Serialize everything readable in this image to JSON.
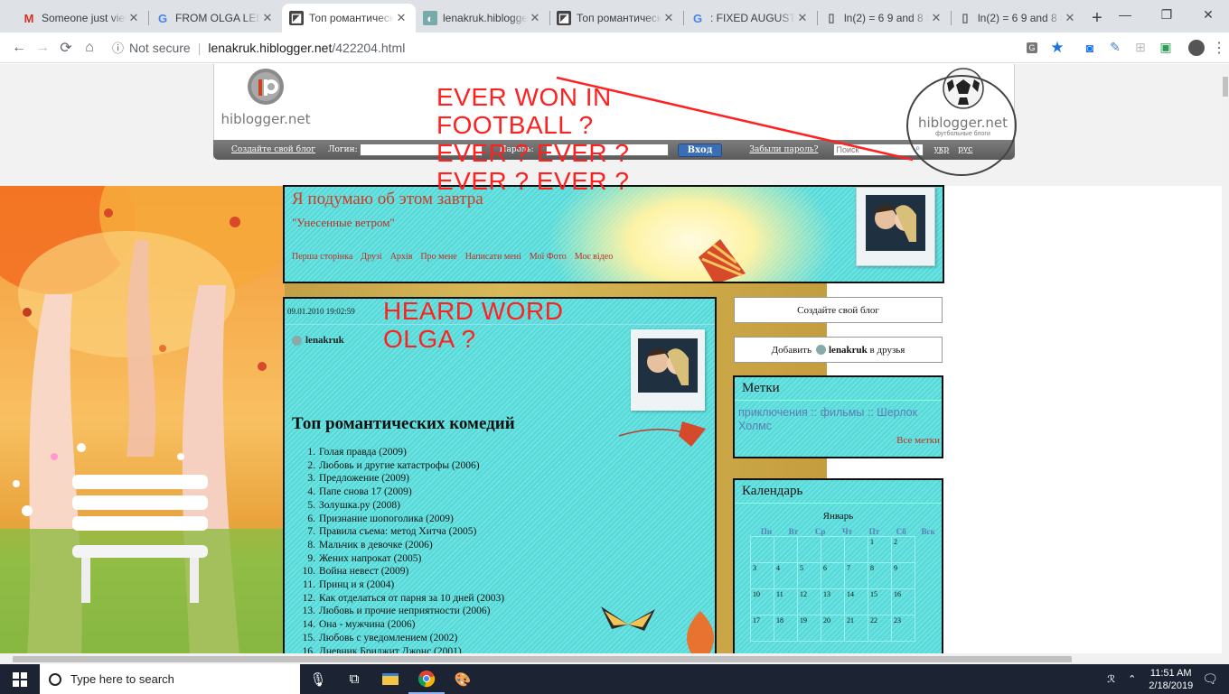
{
  "browser": {
    "tabs": [
      {
        "title": "Someone just view",
        "icon": "gmail-icon",
        "active": false
      },
      {
        "title": "FROM OLGA LEDN",
        "icon": "google-icon",
        "active": false
      },
      {
        "title": "Топ романтическ",
        "icon": "hiblogger-icon",
        "active": true
      },
      {
        "title": "lenakruk.hiblogge",
        "icon": "hiblogger-user-icon",
        "active": false
      },
      {
        "title": "Топ романтическ",
        "icon": "hiblogger-icon",
        "active": false
      },
      {
        "title": ": FIXED AUGUST 3",
        "icon": "google-icon",
        "active": false
      },
      {
        "title": "ln(2) = 6 9 and 8 =",
        "icon": "page-icon",
        "active": false
      },
      {
        "title": "ln(2) = 6 9 and 8 =",
        "icon": "page-icon",
        "active": false
      }
    ],
    "address": {
      "security": "Not secure",
      "host": "lenakruk.hiblogger.net",
      "path": "/422204.html"
    }
  },
  "hiblogger": {
    "logo_left": "hiblogger.net",
    "logo_right": "hiblogger.net",
    "logo_right_sub": "футбольные блоги",
    "create_blog": "Создайте свой блог",
    "login_label": "Логин:",
    "password_label": "Пароль:",
    "enter_button": "Вход",
    "forgot": "Забыли пароль?",
    "search_placeholder": "Поиск",
    "lang_ukr": "укр",
    "lang_rus": "рус"
  },
  "blog": {
    "title": "Я подумаю об этом завтра",
    "subtitle": "\"Унесенные ветром\"",
    "nav": [
      "Перша сторінка",
      "Друзі",
      "Архів",
      "Про мене",
      "Написати мені",
      "Мої Фото",
      "Моє відео"
    ]
  },
  "post": {
    "date": "09.01.2010 19:02:59",
    "author": "lenakruk",
    "title": "Топ романтических комедий",
    "items": [
      "Голая правда (2009)",
      "Любовь и другие катастрофы (2006)",
      "Предложение (2009)",
      "Папе снова 17 (2009)",
      "Золушка.ру (2008)",
      "Признание шопоголика (2009)",
      "Правила съема: метод Хитча (2005)",
      "Мальчик в девочке (2006)",
      "Жених напрокат (2005)",
      "Война невест (2009)",
      "Принц и я (2004)",
      "Как отделаться от парня за 10 дней (2003)",
      "Любовь и прочие неприятности (2006)",
      "Она - мужчина (2006)",
      "Любовь с уведомлением (2002)",
      "Дневник Бриджит Джонс (2001)"
    ]
  },
  "sidebar": {
    "create_blog": "Создайте свой блог",
    "add_friend_prefix": "Добавить",
    "add_friend_user": "lenakruk",
    "add_friend_suffix": "в друзья",
    "tags_title": "Метки",
    "tags_text": "приключения :: фильмы :: Шерлок Холмс",
    "all_tags": "Все метки",
    "calendar_title": "Календарь",
    "calendar_month": "Январь",
    "weekdays": [
      "Пн",
      "Вт",
      "Ср",
      "Чт",
      "Пт",
      "Сб",
      "Вск"
    ],
    "weeks": [
      [
        "",
        "",
        "",
        "",
        "",
        "1",
        "2"
      ],
      [
        "3",
        "4",
        "5",
        "6",
        "7",
        "8",
        "9"
      ],
      [
        "10",
        "11",
        "12",
        "13",
        "14",
        "15",
        "16"
      ],
      [
        "17",
        "18",
        "19",
        "20",
        "21",
        "22",
        "23"
      ]
    ]
  },
  "annotations": {
    "top_lines": [
      "EVER WON IN",
      "FOOTBALL ?",
      "EVER ? EVER ?",
      "EVER ? EVER ?"
    ],
    "post_lines": [
      "HEARD WORD",
      "OLGA ?"
    ],
    "color": "#ff2020"
  },
  "taskbar": {
    "search_placeholder": "Type here to search",
    "time": "11:51 AM",
    "date": "2/18/2019"
  }
}
